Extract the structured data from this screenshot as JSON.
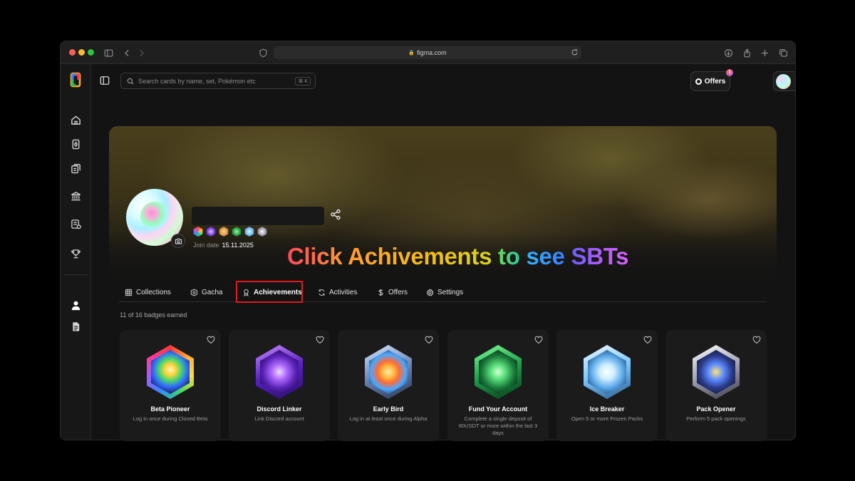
{
  "browser": {
    "url": "figma.com"
  },
  "search": {
    "placeholder": "Search cards by name, set, Pokémon etc",
    "shortcut": "⌘ K"
  },
  "header": {
    "offers_label": "Offers",
    "notification_count": "1"
  },
  "profile": {
    "join_label": "Join date",
    "join_date": "15.11.2025"
  },
  "headline": {
    "part1": "Click",
    "part2": "Achivements",
    "part3": "to",
    "part4": "see",
    "part5": "SBTs"
  },
  "tabs": [
    {
      "label": "Collections",
      "icon": "grid-icon"
    },
    {
      "label": "Gacha",
      "icon": "gacha-icon"
    },
    {
      "label": "Achievements",
      "icon": "award-icon",
      "active": true
    },
    {
      "label": "Activities",
      "icon": "refresh-icon"
    },
    {
      "label": "Offers",
      "icon": "dollar-icon"
    },
    {
      "label": "Settings",
      "icon": "gear-icon"
    }
  ],
  "achievements": {
    "summary": "11 of 16 badges earned",
    "cards": [
      {
        "title": "Beta Pioneer",
        "desc": "Log in once during Closed Beta"
      },
      {
        "title": "Discord Linker",
        "desc": "Link Discord account"
      },
      {
        "title": "Early Bird",
        "desc": "Log in at least once during Alpha"
      },
      {
        "title": "Fund Your Account",
        "desc": "Complete a single deposit of 60USDT or more within the last 3 days"
      },
      {
        "title": "Ice Breaker",
        "desc": "Open 5 or more Frozen Packs"
      },
      {
        "title": "Pack Opener",
        "desc": "Perform 5 pack openings"
      }
    ]
  },
  "colors": {
    "highlight": "#e01a1a",
    "background": "#131313",
    "card": "#1b1b1b"
  }
}
